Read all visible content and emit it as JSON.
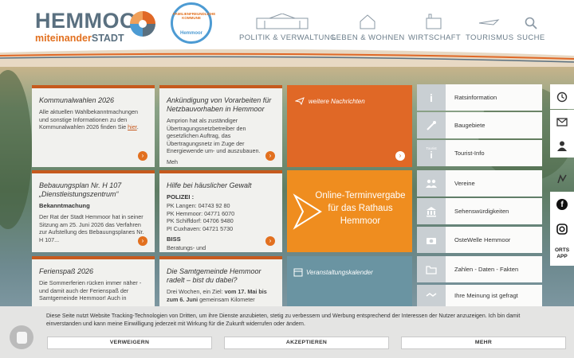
{
  "logo": {
    "name": "HEMMOOR",
    "sub_a": "miteinander",
    "sub_b": "STADT"
  },
  "seal": {
    "ring": "FAMILIENFREUNDLICHE KOMMUNE",
    "town": "Hemmoor"
  },
  "nav": [
    {
      "label": "POLITIK & VERWALTUNG"
    },
    {
      "label": "LEBEN & WOHNEN"
    },
    {
      "label": "WIRTSCHAFT"
    },
    {
      "label": "TOURISMUS"
    },
    {
      "label": "SUCHE"
    }
  ],
  "tiles": {
    "t1": {
      "title": "Kommunalwahlen 2026",
      "text": "Alle aktuellen Wahlbekanntmachungen und sonstige Informationen zu den Kommunalwahlen 2026 finden Sie ",
      "link": "hier",
      "end": "."
    },
    "t2": {
      "title": "Ankündigung von Vorarbeiten für Netzbauvorhaben in Hemmoor",
      "text": "Amprion hat als zuständiger Übertragungsnetzbetreiber den gesetzlichen Auftrag, das Übertragungsnetz im Zuge der Energiewende um- und auszubauen.",
      "more": "Meh"
    },
    "t3": {
      "title": "Bebauungsplan Nr. H 107 „Dienstleistungszentrum“",
      "bold": "Bekanntmachung",
      "text": "Der Rat der Stadt Hemmoor hat in seiner Sitzung am 25. Juni 2026 das Verfahren zur Aufstellung des Bebauungsplanes Nr. H 107..."
    },
    "t4": {
      "title": "Hilfe bei häuslicher Gewalt",
      "bold": "POLIZEI :",
      "lines": [
        "PK Langen: 04743 92 80",
        "PK Hemmoor: 04771 6070",
        "PK Schiffdorf: 04706 9480",
        "PI Cuxhaven: 04721 5730"
      ],
      "bold2": "BISS",
      "more": "Beratungs- und"
    },
    "t5": {
      "title": "Ferienspaß 2026",
      "text": "Die Sommerferien rücken immer näher - und damit auch der Ferienspaß der Samtgemeinde Hemmoor! Auch in"
    },
    "t6": {
      "title": "Die Samtgemeinde Hemmoor radelt – bist du dabei?",
      "pre": "Drei Wochen, ein Ziel: ",
      "b1": "vom 17. Mai bis zum 6. Juni",
      "post": " gemeinsam Kilometer"
    }
  },
  "orange": {
    "news": "weitere Nachrichten",
    "termin": "Online-Terminvergabe für das Rathaus Hemmoor",
    "events": "Veranstaltungskalender"
  },
  "right": [
    {
      "label": "Ratsinformation",
      "icon": "info-icon"
    },
    {
      "label": "Baugebiete",
      "icon": "shovel-icon"
    },
    {
      "label": "Tourist-Info",
      "icon": "tourist-info-icon",
      "tag": "Tourist"
    },
    {
      "label": "Vereine",
      "icon": "group-icon"
    },
    {
      "label": "Sehenswürdigkeiten",
      "icon": "museum-icon"
    },
    {
      "label": "OsteWelle Hemmoor",
      "icon": "camera-icon"
    },
    {
      "label": "Zahlen - Daten - Fakten",
      "icon": "folder-icon"
    },
    {
      "label": "Ihre Meinung ist gefragt",
      "icon": "handshake-icon"
    }
  ],
  "side": {
    "orts": "ORTS",
    "app": "APP"
  },
  "cookie": {
    "text": "Diese Seite nutzt Website Tracking-Technologien von Dritten, um ihre Dienste anzubieten, stetig zu verbessern und Werbung entsprechend der Interessen der Nutzer anzuzeigen. Ich bin damit einverstanden und kann meine Einwilligung jederzeit mit Wirkung für die Zukunft widerrufen oder ändern.",
    "deny": "VERWEIGERN",
    "accept": "AKZEPTIEREN",
    "more": "MEHR"
  },
  "colors": {
    "orange": "#e06826",
    "slate": "#5a7080",
    "blue": "#4d9bd3"
  }
}
